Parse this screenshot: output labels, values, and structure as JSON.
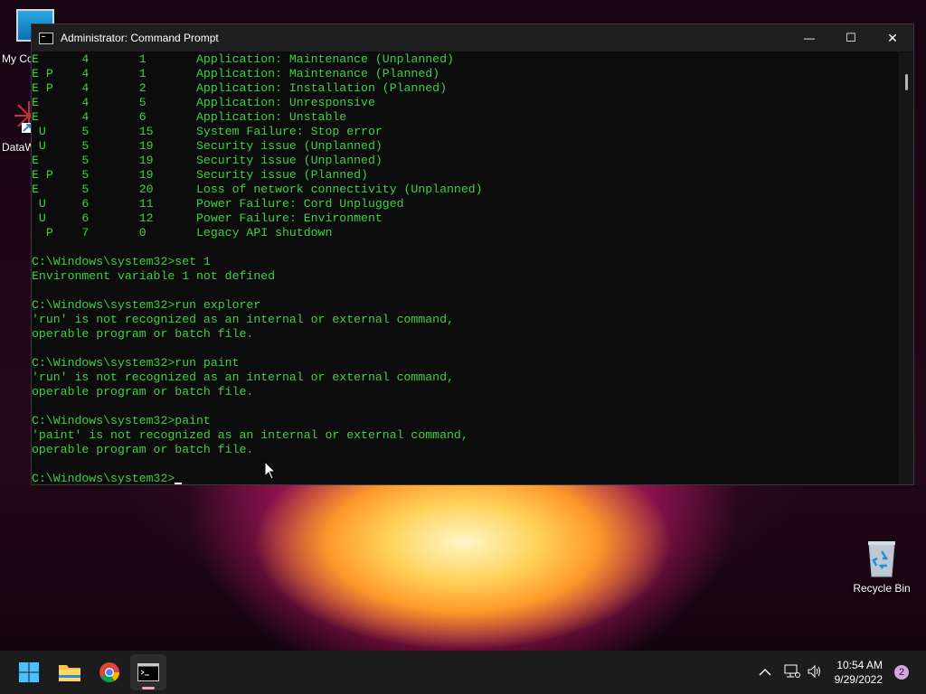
{
  "window": {
    "title": "Administrator: Command Prompt",
    "minimize_label": "—",
    "maximize_label": "☐",
    "close_label": "✕"
  },
  "console_lines": [
    "E      4       1       Application: Maintenance (Unplanned)",
    "E P    4       1       Application: Maintenance (Planned)",
    "E P    4       2       Application: Installation (Planned)",
    "E      4       5       Application: Unresponsive",
    "E      4       6       Application: Unstable",
    " U     5       15      System Failure: Stop error",
    " U     5       19      Security issue (Unplanned)",
    "E      5       19      Security issue (Unplanned)",
    "E P    5       19      Security issue (Planned)",
    "E      5       20      Loss of network connectivity (Unplanned)",
    " U     6       11      Power Failure: Cord Unplugged",
    " U     6       12      Power Failure: Environment",
    "  P    7       0       Legacy API shutdown",
    "",
    "C:\\Windows\\system32>set 1",
    "Environment variable 1 not defined",
    "",
    "C:\\Windows\\system32>run explorer",
    "'run' is not recognized as an internal or external command,",
    "operable program or batch file.",
    "",
    "C:\\Windows\\system32>run paint",
    "'run' is not recognized as an internal or external command,",
    "operable program or batch file.",
    "",
    "C:\\Windows\\system32>paint",
    "'paint' is not recognized as an internal or external command,",
    "operable program or batch file.",
    ""
  ],
  "prompt": "C:\\Windows\\system32>",
  "desktop": {
    "my_computer_label": "My Co",
    "datawrapper_label": "DataW",
    "recycle_bin_label": "Recycle Bin"
  },
  "taskbar": {
    "time": "10:54 AM",
    "date": "9/29/2022",
    "notification_count": "2",
    "icons": [
      "windows-start-icon",
      "file-explorer-icon",
      "chrome-icon",
      "terminal-icon"
    ]
  },
  "colors": {
    "console_text": "#3fd13f",
    "console_bg": "#0c0c0c",
    "titlebar": "#1f1f1f",
    "taskbar": "#1c1c1c"
  }
}
